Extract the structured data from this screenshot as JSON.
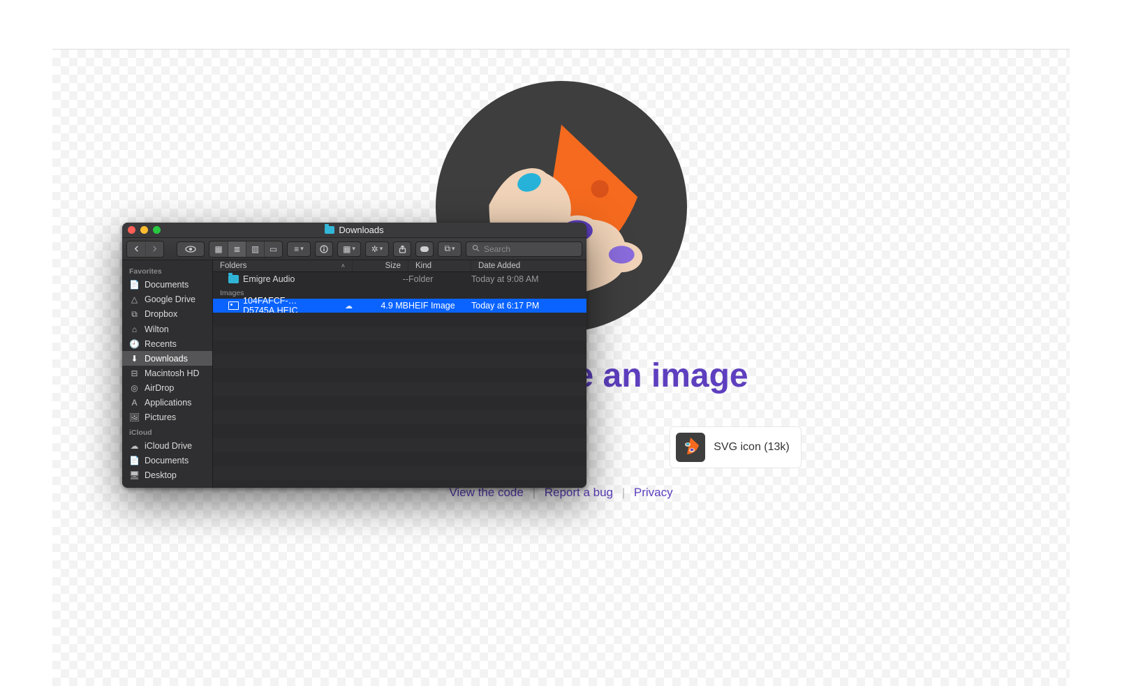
{
  "page": {
    "drop_heading": "Drop or Paste an image",
    "example": {
      "label": "SVG icon (13k)"
    },
    "footer": {
      "view_code": "View the code",
      "report_bug": "Report a bug",
      "privacy": "Privacy"
    }
  },
  "finder": {
    "title": "Downloads",
    "search_placeholder": "Search",
    "sidebar": {
      "sections": [
        {
          "label": "Favorites",
          "items": [
            {
              "icon": "📄",
              "name": "documents",
              "label": "Documents"
            },
            {
              "icon": "△",
              "name": "google-drive",
              "label": "Google Drive"
            },
            {
              "icon": "⧉",
              "name": "dropbox",
              "label": "Dropbox"
            },
            {
              "icon": "⌂",
              "name": "wilton",
              "label": "Wilton"
            },
            {
              "icon": "🕘",
              "name": "recents",
              "label": "Recents"
            },
            {
              "icon": "⬇",
              "name": "downloads",
              "label": "Downloads",
              "selected": true
            },
            {
              "icon": "⊟",
              "name": "macintosh-hd",
              "label": "Macintosh HD"
            },
            {
              "icon": "◎",
              "name": "airdrop",
              "label": "AirDrop"
            },
            {
              "icon": "A",
              "name": "applications",
              "label": "Applications"
            },
            {
              "icon": "🖼",
              "name": "pictures",
              "label": "Pictures"
            }
          ]
        },
        {
          "label": "iCloud",
          "items": [
            {
              "icon": "☁",
              "name": "icloud-drive",
              "label": "iCloud Drive"
            },
            {
              "icon": "📄",
              "name": "documents-2",
              "label": "Documents"
            },
            {
              "icon": "🖥",
              "name": "desktop",
              "label": "Desktop"
            }
          ]
        }
      ]
    },
    "columns": {
      "name": "Folders",
      "size": "Size",
      "kind": "Kind",
      "date": "Date Added",
      "sort_indicator": "˄"
    },
    "groups": [
      {
        "label": "Folders",
        "rows": [
          {
            "type": "folder",
            "name": "Emigre Audio",
            "size": "--",
            "kind": "Folder",
            "date": "Today at 9:08 AM",
            "selected": false
          }
        ]
      },
      {
        "label": "Images",
        "rows": [
          {
            "type": "image",
            "name": "104FAFCF-…D5745A.HEIC",
            "cloud": true,
            "size": "4.9 MB",
            "kind": "HEIF Image",
            "date": "Today at 6:17 PM",
            "selected": true
          }
        ]
      }
    ]
  }
}
